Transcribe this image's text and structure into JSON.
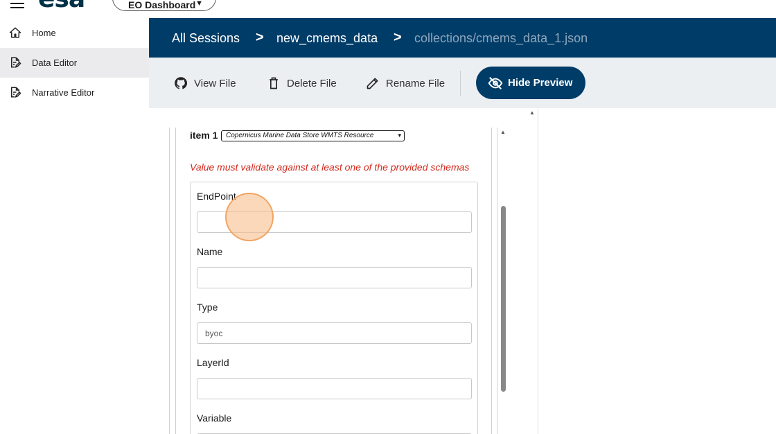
{
  "header": {
    "logo_text": "esa",
    "dashboard_select": "EO Dashboard"
  },
  "sidebar": {
    "items": [
      {
        "label": "Home",
        "icon": "home-icon"
      },
      {
        "label": "Data Editor",
        "icon": "edit-document-icon",
        "active": true
      },
      {
        "label": "Narrative Editor",
        "icon": "edit-document-icon"
      }
    ]
  },
  "breadcrumb": {
    "items": [
      "All Sessions",
      "new_cmems_data",
      "collections/cmems_data_1.json"
    ],
    "separator": ">"
  },
  "toolbar": {
    "view_label": "View File",
    "delete_label": "Delete File",
    "rename_label": "Rename File",
    "hide_preview_label": "Hide Preview"
  },
  "form": {
    "item_title": "item 1",
    "item_type_select": "Copernicus Marine Data Store WMTS Resource",
    "error_message": "Value must validate against at least one of the provided schemas",
    "fields": [
      {
        "label": "EndPoint",
        "value": ""
      },
      {
        "label": "Name",
        "value": ""
      },
      {
        "label": "Type",
        "value": "byoc"
      },
      {
        "label": "LayerId",
        "value": ""
      },
      {
        "label": "Variable",
        "value": ""
      }
    ]
  },
  "colors": {
    "primary": "#003c68",
    "error": "#d32a1e",
    "toolbar_bg": "#eceff2",
    "active_nav_bg": "#ebebed"
  }
}
